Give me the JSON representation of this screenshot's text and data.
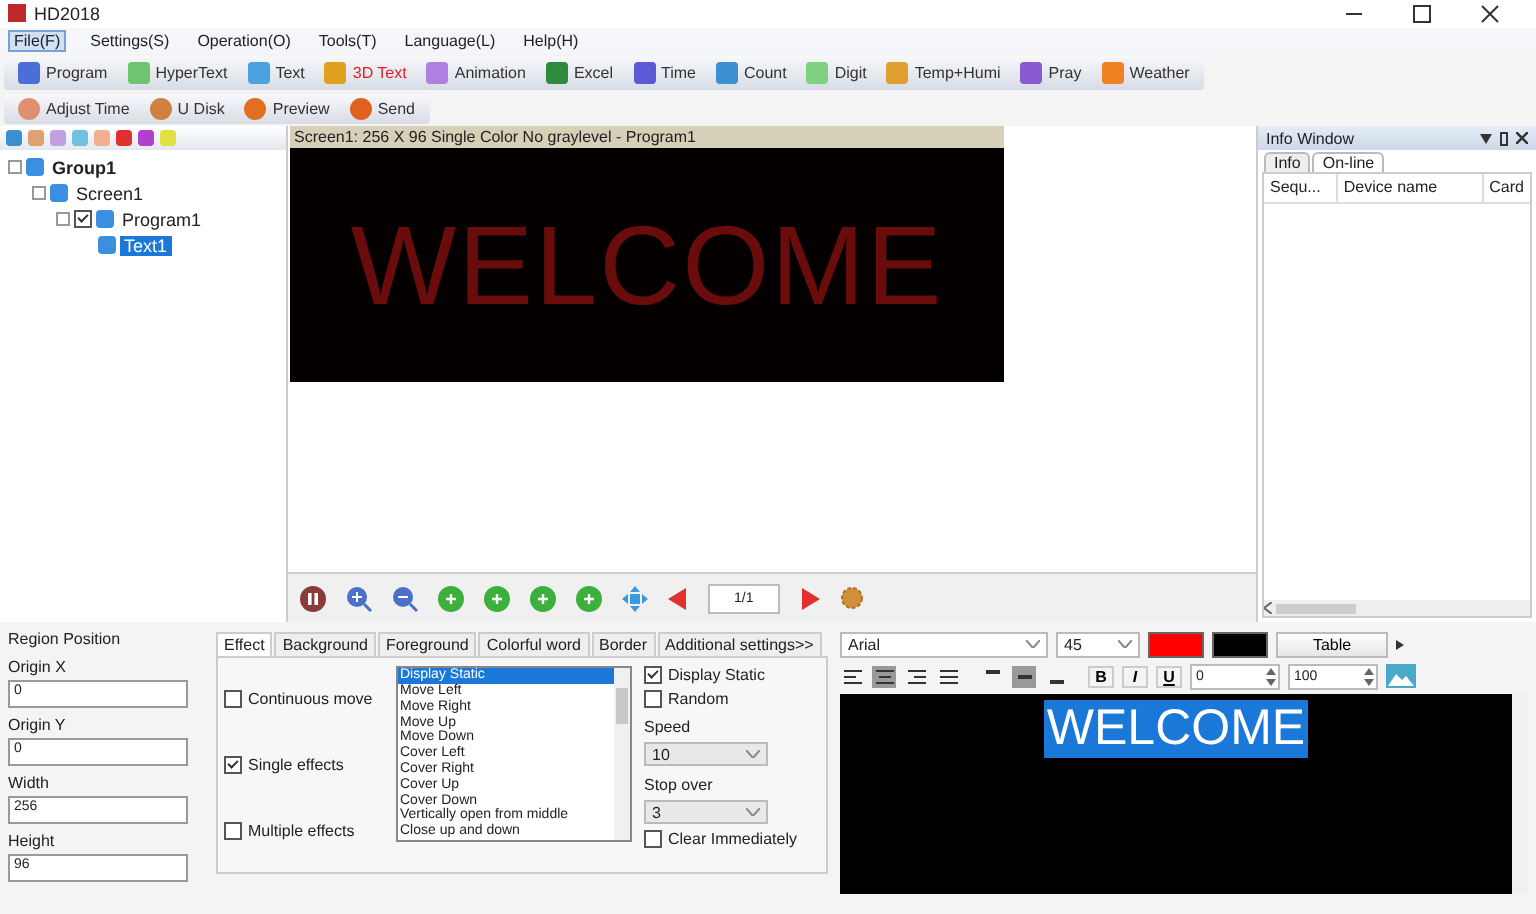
{
  "window": {
    "title": "HD2018"
  },
  "menu": [
    {
      "label": "File(F)",
      "selected": true
    },
    {
      "label": "Settings(S)",
      "selected": false
    },
    {
      "label": "Operation(O)",
      "selected": false
    },
    {
      "label": "Tools(T)",
      "selected": false
    },
    {
      "label": "Language(L)",
      "selected": false
    },
    {
      "label": "Help(H)",
      "selected": false
    }
  ],
  "toolbar": [
    {
      "label": "Program",
      "highlighted": false
    },
    {
      "label": "HyperText",
      "highlighted": false
    },
    {
      "label": "Text",
      "highlighted": false
    },
    {
      "label": "3D Text",
      "highlighted": true
    },
    {
      "label": "Animation",
      "highlighted": false
    },
    {
      "label": "Excel",
      "highlighted": false
    },
    {
      "label": "Time",
      "highlighted": false
    },
    {
      "label": "Count",
      "highlighted": false
    },
    {
      "label": "Digit",
      "highlighted": false
    },
    {
      "label": "Temp+Humi",
      "highlighted": false
    },
    {
      "label": "Pray",
      "highlighted": false
    },
    {
      "label": "Weather",
      "highlighted": false
    }
  ],
  "toolbar2": [
    "Adjust Time",
    "U Disk",
    "Preview",
    "Send"
  ],
  "tree": [
    {
      "label": "Group1",
      "selected": false,
      "children": [
        {
          "label": "Screen1",
          "selected": false,
          "children": [
            {
              "label": "Program1",
              "selected": false,
              "checked": true,
              "children": [
                {
                  "label": "Text1",
                  "selected": true
                }
              ]
            }
          ]
        }
      ]
    }
  ],
  "preview": {
    "caption": "Screen1: 256 X 96  Single Color No graylevel - Program1",
    "text": "WELCOME"
  },
  "playback": {
    "page": "1/1"
  },
  "info_window": {
    "title": "Info Window",
    "tabs": [
      {
        "label": "Info",
        "selected": false
      },
      {
        "label": "On-line",
        "selected": true
      }
    ],
    "columns": [
      "Sequ...",
      "Device name",
      "Card"
    ]
  },
  "region_position": {
    "title": "Region Position",
    "fields": [
      {
        "label": "Origin X",
        "value": "0"
      },
      {
        "label": "Origin Y",
        "value": "0"
      },
      {
        "label": "Width",
        "value": "256"
      },
      {
        "label": "Height",
        "value": "96"
      }
    ]
  },
  "effect_tabs": [
    {
      "label": "Effect",
      "selected": true
    },
    {
      "label": "Background",
      "selected": false
    },
    {
      "label": "Foreground",
      "selected": false
    },
    {
      "label": "Colorful word",
      "selected": false
    },
    {
      "label": "Border",
      "selected": false
    },
    {
      "label": "Additional settings>>",
      "selected": false
    }
  ],
  "effect_modes": [
    {
      "label": "Continuous move",
      "checked": false
    },
    {
      "label": "Single effects",
      "checked": true
    },
    {
      "label": "Multiple effects",
      "checked": false
    }
  ],
  "effects": [
    {
      "label": "Display Static",
      "selected": true
    },
    {
      "label": "Move Left",
      "selected": false
    },
    {
      "label": "Move Right",
      "selected": false
    },
    {
      "label": "Move Up",
      "selected": false
    },
    {
      "label": "Move Down",
      "selected": false
    },
    {
      "label": "Cover Left",
      "selected": false
    },
    {
      "label": "Cover Right",
      "selected": false
    },
    {
      "label": "Cover Up",
      "selected": false
    },
    {
      "label": "Cover Down",
      "selected": false
    },
    {
      "label": "Vertically open from middle",
      "selected": false
    },
    {
      "label": "Close up and down",
      "selected": false
    }
  ],
  "effect_options": [
    {
      "kind": "checkbox",
      "label": "Display Static",
      "checked": true
    },
    {
      "kind": "checkbox",
      "label": "Random",
      "checked": false
    },
    {
      "kind": "select",
      "label": "Speed",
      "value": "10"
    },
    {
      "kind": "select",
      "label": "Stop over",
      "value": "3"
    },
    {
      "kind": "checkbox",
      "label": "Clear Immediately",
      "checked": false
    }
  ],
  "editor": {
    "font": "Arial",
    "size": "45",
    "color_swatches": [
      {
        "color": "#ff0000"
      },
      {
        "color": "#000000"
      }
    ],
    "table_button": "Table",
    "align": [
      {
        "selected": false
      },
      {
        "selected": true
      },
      {
        "selected": false
      },
      {
        "selected": false
      }
    ],
    "valign": [
      {
        "selected": false
      },
      {
        "selected": true
      },
      {
        "selected": false
      }
    ],
    "format_buttons": [
      "B",
      "I",
      "U"
    ],
    "spin_1": "0",
    "spin_2": "100",
    "text": "WELCOME"
  }
}
